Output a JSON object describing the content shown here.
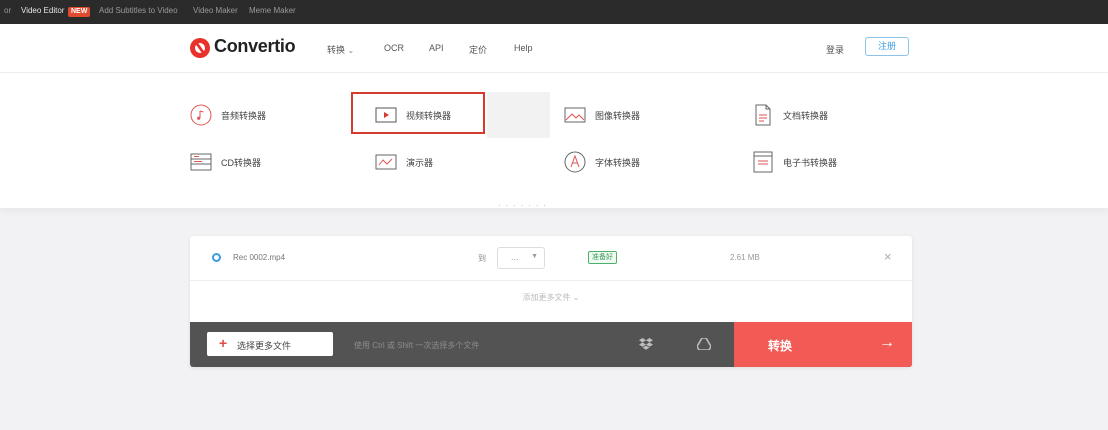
{
  "topbar": {
    "items": [
      {
        "label": "or"
      },
      {
        "label": "Video Editor"
      },
      {
        "label": "Add Subtitles to Video"
      },
      {
        "label": "Video Maker"
      },
      {
        "label": "Meme Maker"
      }
    ],
    "new_badge": "NEW"
  },
  "header": {
    "logo_text": "Convertio",
    "nav": [
      {
        "label": "转换"
      },
      {
        "label": "OCR"
      },
      {
        "label": "API"
      },
      {
        "label": "定价"
      },
      {
        "label": "Help"
      }
    ],
    "login_label": "登录",
    "signup_label": "注册"
  },
  "menu": {
    "items": [
      {
        "label": "音频转换器",
        "icon": "audio-icon"
      },
      {
        "label": "视频转换器",
        "icon": "video-play-icon"
      },
      {
        "label": "图像转换器",
        "icon": "image-icon"
      },
      {
        "label": "文档转换器",
        "icon": "document-icon"
      },
      {
        "label": "CD转换器",
        "icon": "archive-icon"
      },
      {
        "label": "演示器",
        "icon": "presentation-icon"
      },
      {
        "label": "字体转换器",
        "icon": "font-icon"
      },
      {
        "label": "电子书转换器",
        "icon": "ebook-icon"
      }
    ],
    "highlighted_item": "视频转换器",
    "highlight_color": "#d53a2f"
  },
  "file": {
    "name": "Rec 0002.mp4",
    "to_label": "到",
    "format_value": "...",
    "status_badge": "准备好",
    "size": "2.61 MB"
  },
  "more_link": "添加更多文件",
  "action": {
    "add_button_label": "选择更多文件",
    "hint": "使用 Ctrl 或 Shift 一次选择多个文件",
    "convert_label": "转换",
    "convert_color": "#f25a55"
  }
}
